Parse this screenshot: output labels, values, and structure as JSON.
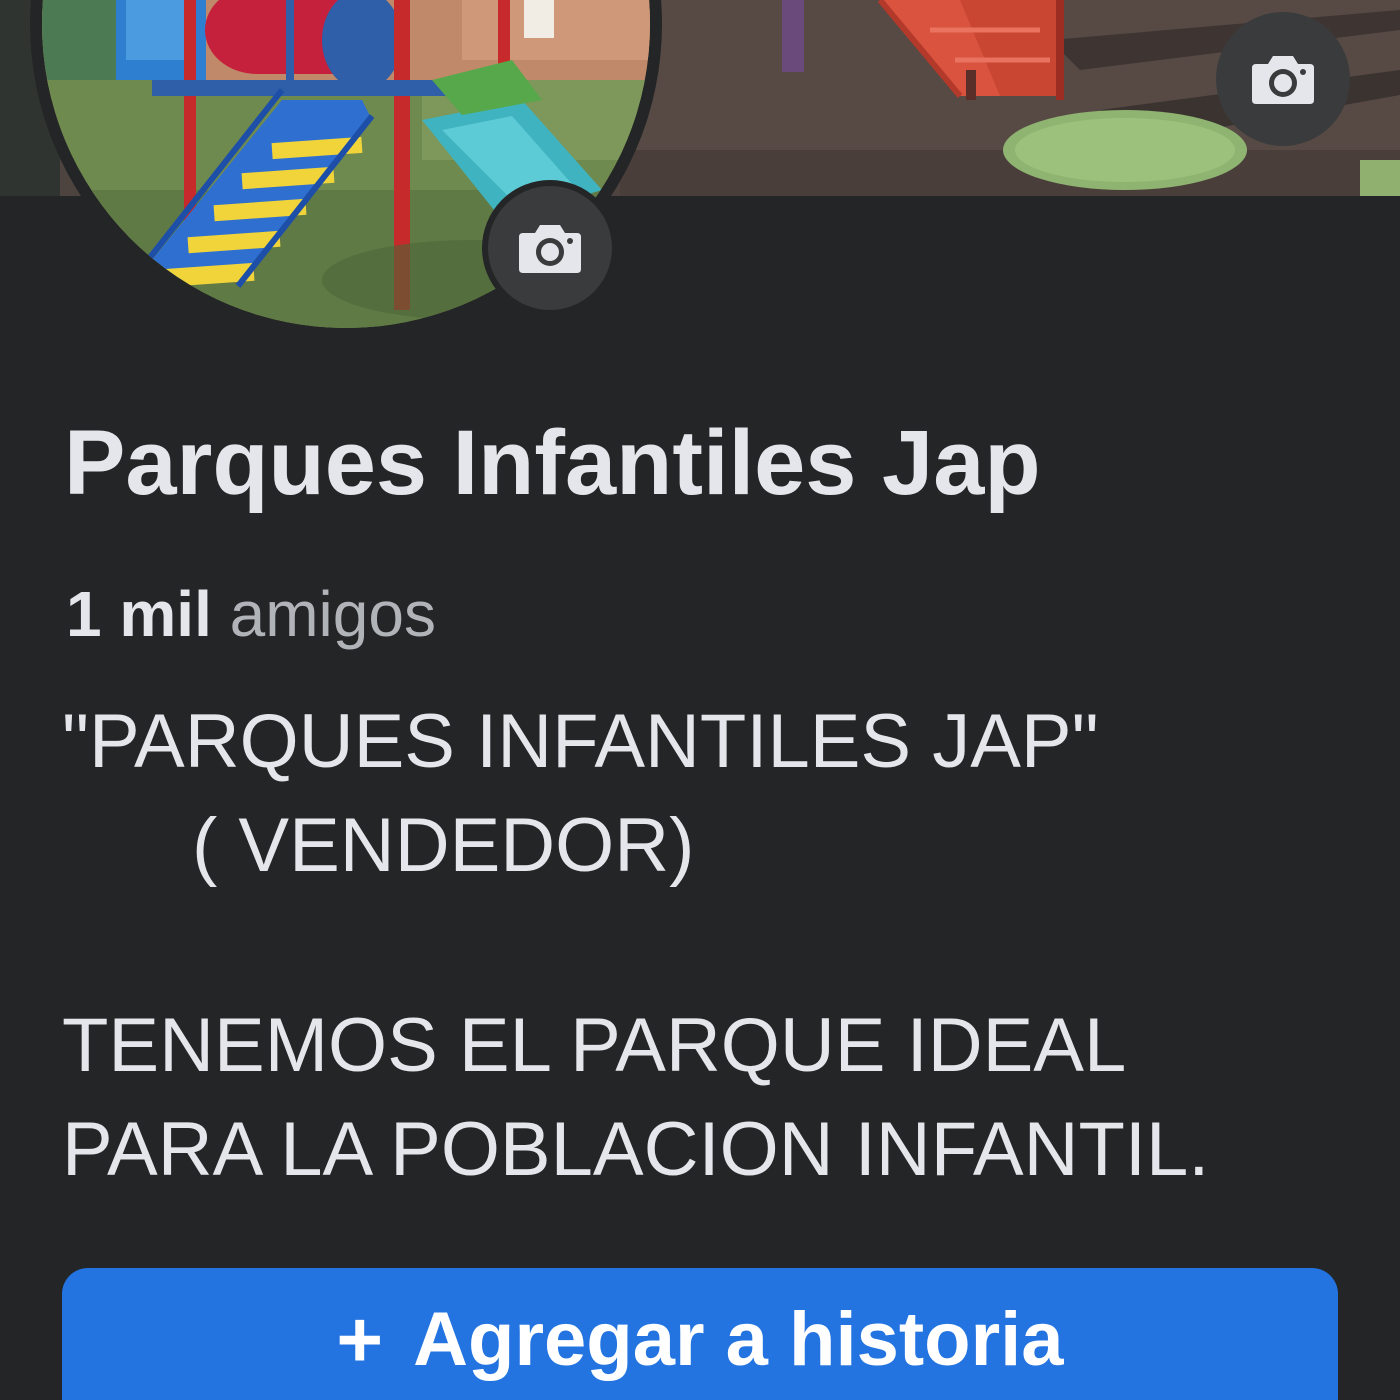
{
  "profile": {
    "name": "Parques Infantiles Jap",
    "friends_count": "1 mil",
    "friends_label": "amigos",
    "bio": {
      "line1": "\"PARQUES INFANTILES JAP\"",
      "line2": "( VENDEDOR)",
      "line3": "TENEMOS EL PARQUE IDEAL",
      "line4": "PARA LA POBLACION INFANTIL."
    }
  },
  "actions": {
    "add_story_icon": "+",
    "add_story_label": "Agregar a historia"
  },
  "icons": {
    "cover_camera": "camera-icon",
    "avatar_camera": "camera-icon"
  },
  "colors": {
    "background": "#242526",
    "primary_button": "#2374e1",
    "text_primary": "#e4e6eb",
    "text_secondary": "#b0b3b8",
    "icon_button": "#3a3b3c"
  }
}
